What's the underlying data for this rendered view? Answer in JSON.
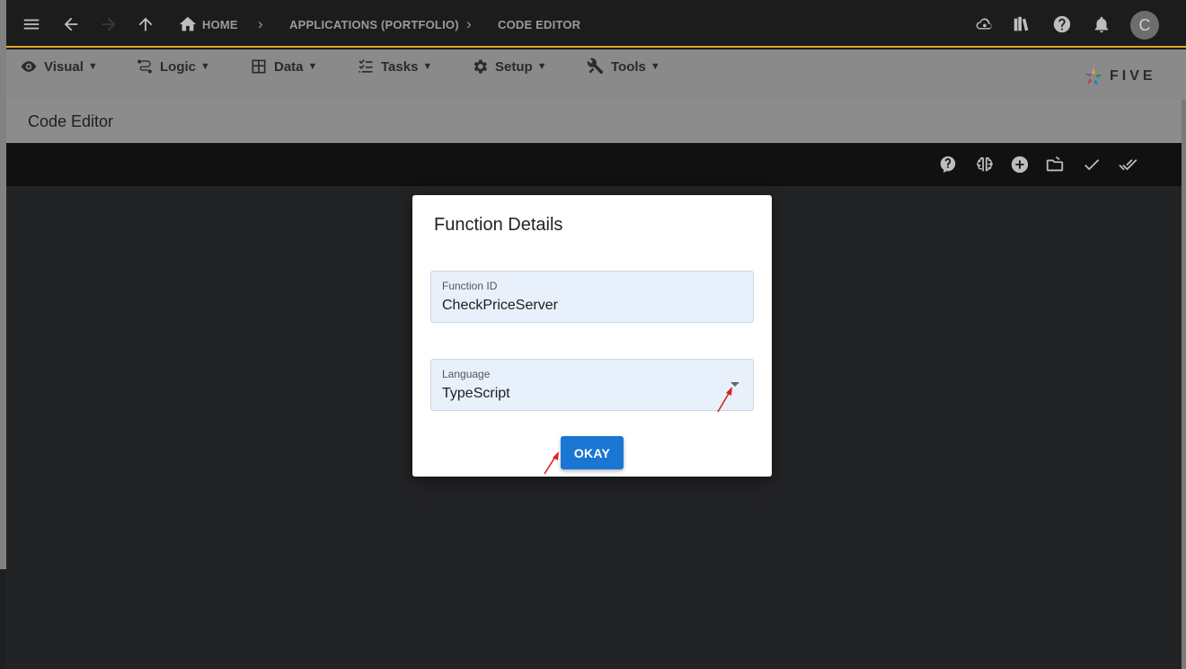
{
  "topbar": {
    "crumbs": [
      "HOME",
      "APPLICATIONS (PORTFOLIO)",
      "CODE EDITOR"
    ],
    "avatar_letter": "C",
    "icons": [
      "menu-icon",
      "back-arrow-icon",
      "forward-arrow-icon",
      "up-arrow-icon",
      "home-icon",
      "cloud-sync-icon",
      "library-icon",
      "help-icon",
      "bell-icon"
    ]
  },
  "menubar": {
    "items": [
      {
        "label": "Visual",
        "icon": "eye-icon"
      },
      {
        "label": "Logic",
        "icon": "logic-flow-icon"
      },
      {
        "label": "Data",
        "icon": "table-icon"
      },
      {
        "label": "Tasks",
        "icon": "checklist-icon"
      },
      {
        "label": "Setup",
        "icon": "gear-icon"
      },
      {
        "label": "Tools",
        "icon": "wrench-icon"
      }
    ],
    "arrow": "▼",
    "logo_text": "FIVE"
  },
  "page": {
    "title": "Code Editor"
  },
  "toolbar": {
    "icons": [
      "help-bubble-icon",
      "brain-icon",
      "add-circle-icon",
      "folder-open-icon",
      "check-icon",
      "double-check-icon"
    ]
  },
  "dialog": {
    "title": "Function Details",
    "function_id": {
      "label": "Function ID",
      "value": "CheckPriceServer"
    },
    "language": {
      "label": "Language",
      "value": "TypeScript"
    },
    "okay_label": "OKAY"
  },
  "colors": {
    "accent": "#1976d2",
    "topbar_border": "#e0a52a",
    "annotation": "#e02020"
  }
}
